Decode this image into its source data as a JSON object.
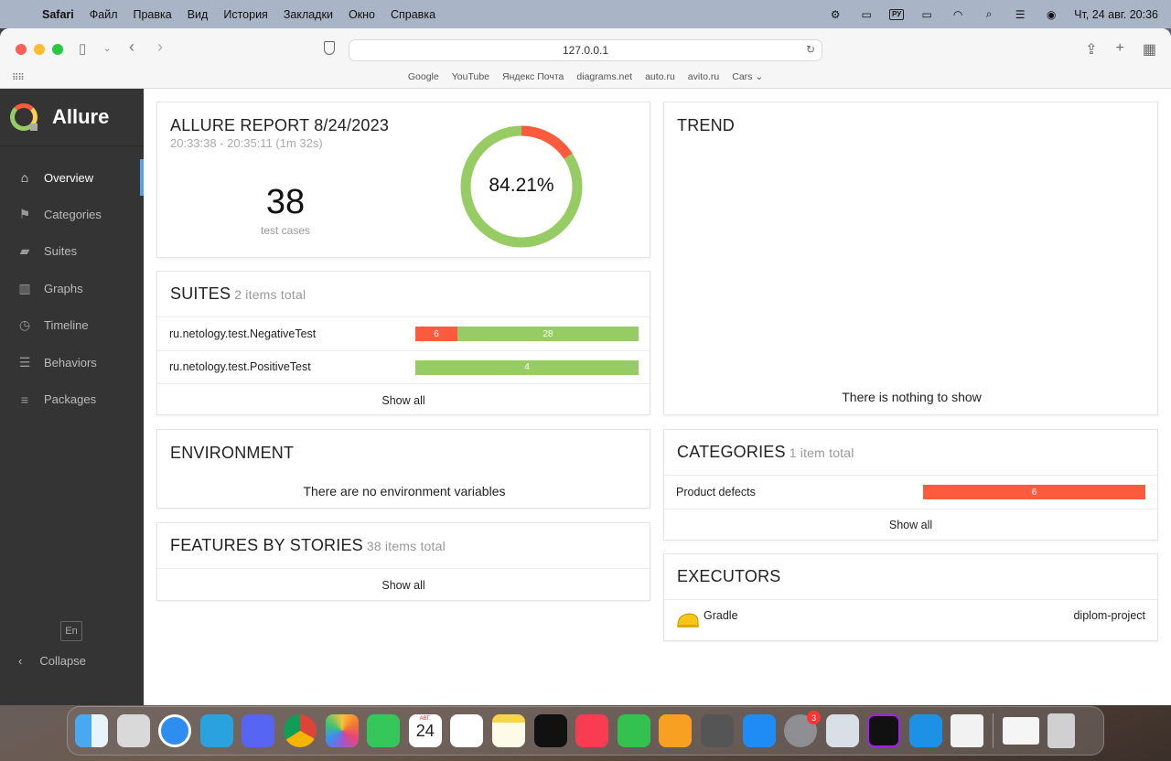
{
  "menubar": {
    "app": "Safari",
    "items": [
      "Файл",
      "Правка",
      "Вид",
      "История",
      "Закладки",
      "Окно",
      "Справка"
    ],
    "lang_badge": "РУ",
    "clock": "Чт, 24 авг.  20:36"
  },
  "browser": {
    "url": "127.0.0.1",
    "bookmarks": [
      "Google",
      "YouTube",
      "Яндекс Почта",
      "diagrams.net",
      "auto.ru",
      "avito.ru",
      "Cars ⌄"
    ]
  },
  "sidebar": {
    "brand": "Allure",
    "items": [
      {
        "label": "Overview",
        "icon": "home-icon",
        "glyph": "⌂"
      },
      {
        "label": "Categories",
        "icon": "flag-icon",
        "glyph": "⚑"
      },
      {
        "label": "Suites",
        "icon": "briefcase-icon",
        "glyph": "▰"
      },
      {
        "label": "Graphs",
        "icon": "bar-chart-icon",
        "glyph": "▥"
      },
      {
        "label": "Timeline",
        "icon": "clock-icon",
        "glyph": "◷"
      },
      {
        "label": "Behaviors",
        "icon": "list-icon",
        "glyph": "☰"
      },
      {
        "label": "Packages",
        "icon": "align-left-icon",
        "glyph": "≡"
      }
    ],
    "lang": "En",
    "collapse": "Collapse"
  },
  "summary": {
    "title": "ALLURE REPORT 8/24/2023",
    "time": "20:33:38 - 20:35:11 (1m 32s)",
    "count": "38",
    "count_label": "test cases",
    "percent": "84.21%",
    "pass_fraction": 0.8421,
    "colors": {
      "failed": "#fd5a3e",
      "passed": "#97cc64"
    }
  },
  "suites": {
    "title": "SUITES",
    "count": "2 items total",
    "rows": [
      {
        "name": "ru.netology.test.NegativeTest",
        "failed": "6",
        "passed": "28"
      },
      {
        "name": "ru.netology.test.PositiveTest",
        "failed": "",
        "passed": "4"
      }
    ],
    "show_all": "Show all"
  },
  "environment": {
    "title": "ENVIRONMENT",
    "empty": "There are no environment variables"
  },
  "features": {
    "title": "FEATURES BY STORIES",
    "count": "38 items total",
    "show_all": "Show all"
  },
  "trend": {
    "title": "TREND",
    "empty": "There is nothing to show"
  },
  "categories": {
    "title": "CATEGORIES",
    "count": "1 item total",
    "rows": [
      {
        "name": "Product defects",
        "failed": "6"
      }
    ],
    "show_all": "Show all"
  },
  "executors": {
    "title": "EXECUTORS",
    "name": "Gradle",
    "build": "diplom-project"
  },
  "dock": {
    "calendar_month": "АВГ.",
    "calendar_day": "24",
    "badge": "3"
  }
}
